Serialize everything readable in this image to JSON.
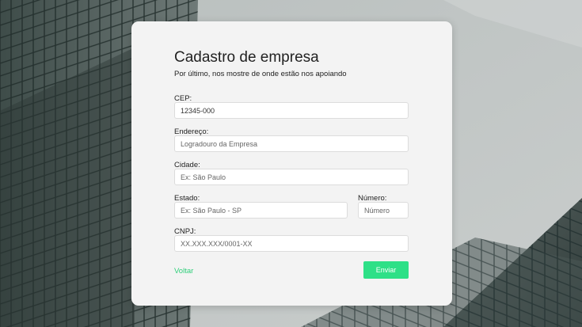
{
  "form": {
    "title": "Cadastro de empresa",
    "subtitle": "Por último, nos mostre de onde estão nos apoiando",
    "cep": {
      "label": "CEP:",
      "value": "12345-000"
    },
    "endereco": {
      "label": "Endereço:",
      "placeholder": "Logradouro da Empresa"
    },
    "cidade": {
      "label": "Cidade:",
      "placeholder": "Ex: São Paulo"
    },
    "estado": {
      "label": "Estado:",
      "placeholder": "Ex: São Paulo - SP"
    },
    "numero": {
      "label": "Número:",
      "placeholder": "Número"
    },
    "cnpj": {
      "label": "CNPJ:",
      "placeholder": "XX.XXX.XXX/0001-XX"
    },
    "back_label": "Voltar",
    "submit_label": "Enviar"
  },
  "colors": {
    "accent": "#2ee087",
    "link": "#2fcf7a",
    "card": "#f3f3f3",
    "background": "#8e9694"
  }
}
